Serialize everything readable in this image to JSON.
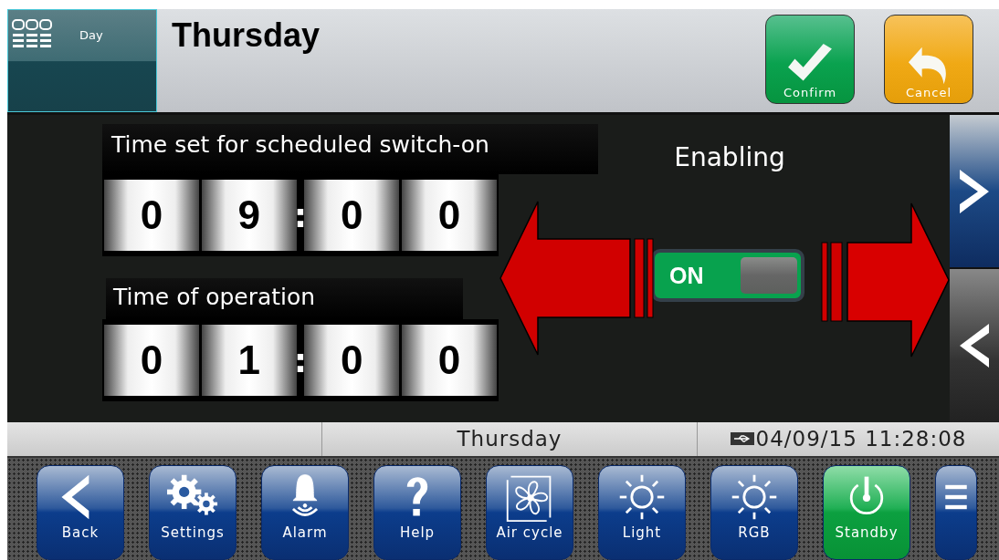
{
  "header": {
    "tile_label": "Day",
    "title": "Thursday",
    "buttons": [
      {
        "kind": "confirm",
        "label": "Confirm"
      },
      {
        "kind": "cancel",
        "label": "Cancel"
      }
    ]
  },
  "fields": [
    {
      "label": "Time set for scheduled switch-on",
      "digits": [
        "0",
        "9",
        "0",
        "0"
      ],
      "separator": ":"
    },
    {
      "label": "Time of operation",
      "digits": [
        "0",
        "1",
        "0",
        "0"
      ],
      "separator": ":"
    }
  ],
  "enabling": {
    "label": "Enabling",
    "toggle": {
      "label": "ON",
      "on": true
    }
  },
  "status_bar": {
    "day": "Thursday",
    "datetime": "04/09/15 11:28:08"
  },
  "toolbar": [
    {
      "kind": "back",
      "label": "Back",
      "active": false
    },
    {
      "kind": "settings",
      "label": "Settings",
      "active": false
    },
    {
      "kind": "alarm",
      "label": "Alarm",
      "active": false
    },
    {
      "kind": "help",
      "label": "Help",
      "active": false
    },
    {
      "kind": "fan",
      "label": "Air cycle",
      "active": false
    },
    {
      "kind": "light",
      "label": "Light",
      "active": false
    },
    {
      "kind": "light",
      "label": "RGB",
      "active": false
    },
    {
      "kind": "power",
      "label": "Standby",
      "active": true
    },
    {
      "kind": "menu",
      "active": false
    }
  ]
}
